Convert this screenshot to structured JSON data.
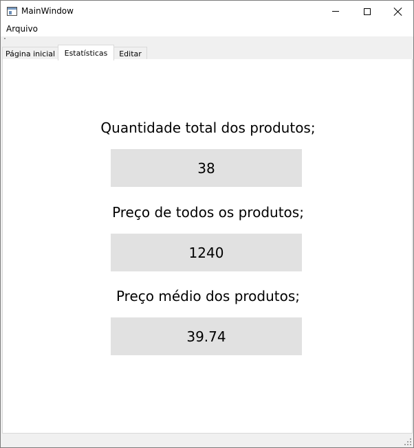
{
  "window": {
    "title": "MainWindow"
  },
  "menubar": {
    "items": [
      {
        "label": "Arquivo"
      }
    ]
  },
  "tabs": [
    {
      "label": "Página inicial",
      "active": false
    },
    {
      "label": "Estatísticas",
      "active": true
    },
    {
      "label": "Editar",
      "active": false
    }
  ],
  "stats": {
    "total_quantity_label": "Quantidade total dos produtos;",
    "total_quantity_value": "38",
    "total_price_label": "Preço de todos os produtos;",
    "total_price_value": "1240",
    "average_price_label": "Preço médio dos produtos;",
    "average_price_value": "39.74"
  },
  "icons": {
    "app": "app-window-icon",
    "minimize": "minimize-icon",
    "maximize": "maximize-icon",
    "close": "close-icon"
  }
}
